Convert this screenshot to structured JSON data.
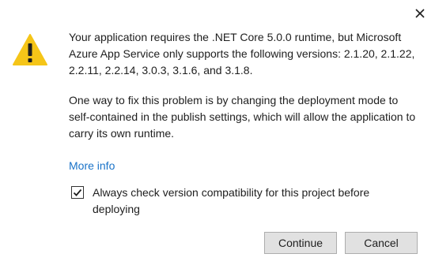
{
  "dialog": {
    "icon": "warning-icon",
    "message": "Your application requires the .NET Core 5.0.0 runtime, but Microsoft Azure App Service only supports the following versions: 2.1.20, 2.1.22, 2.2.11, 2.2.14, 3.0.3, 3.1.6, and 3.1.8.",
    "suggestion": "One way to fix this problem is by changing the deployment mode to self-contained in the publish settings, which will allow the application to carry its own runtime.",
    "more_info_label": "More info",
    "checkbox": {
      "label": "Always check version compatibility for this project before deploying",
      "checked": true
    },
    "buttons": {
      "continue_label": "Continue",
      "cancel_label": "Cancel"
    },
    "close_icon": "close-icon"
  },
  "colors": {
    "warning_fill": "#f5c518",
    "warning_mark": "#1e1e1e",
    "link": "#1a73c8",
    "button_bg": "#e1e1e1",
    "button_border": "#adadad"
  }
}
